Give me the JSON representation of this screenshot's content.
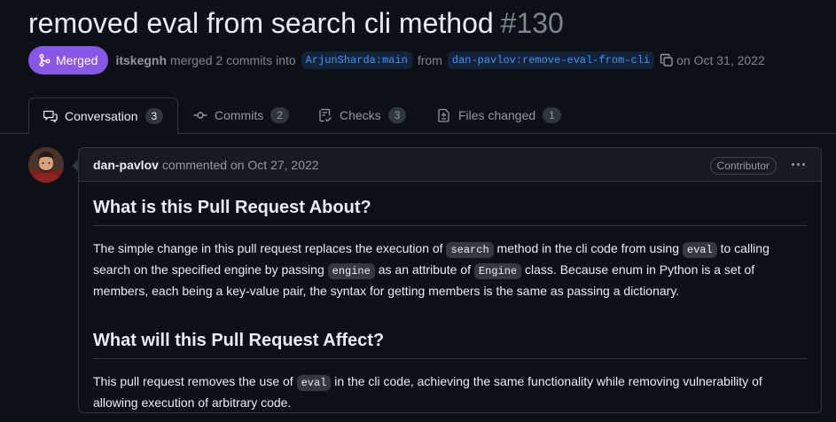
{
  "pr": {
    "title": "removed eval from search cli method",
    "number": "#130",
    "status": "Merged",
    "author": "itskegnh",
    "merged_text": "merged 2 commits into",
    "base_branch": "ArjunSharda:main",
    "from_text": "from",
    "head_branch": "dan-pavlov:remove-eval-from-cli",
    "date_text": "on Oct 31, 2022"
  },
  "tabs": [
    {
      "label": "Conversation",
      "count": "3",
      "icon": "comment-discussion-icon"
    },
    {
      "label": "Commits",
      "count": "2",
      "icon": "git-commit-icon"
    },
    {
      "label": "Checks",
      "count": "3",
      "icon": "checklist-icon"
    },
    {
      "label": "Files changed",
      "count": "1",
      "icon": "file-diff-icon"
    }
  ],
  "comment": {
    "author": "dan-pavlov",
    "action": "commented on Oct 27, 2022",
    "role": "Contributor",
    "h1": "What is this Pull Request About?",
    "p1": [
      "The simple change in this pull request replaces the execution of ",
      "search",
      " method in the cli code from using ",
      "eval",
      " to calling search on the specified engine by passing ",
      "engine",
      " as an attribute of ",
      "Engine",
      " class. Because enum in Python is a set of members, each being a key-value pair, the syntax for getting members is the same as passing a dictionary."
    ],
    "h2": "What will this Pull Request Affect?",
    "p2": [
      "This pull request removes the use of ",
      "eval",
      " in the cli code, achieving the same functionality while removing vulnerability of allowing execution of arbitrary code."
    ]
  },
  "colors": {
    "background": "#0d1117",
    "merged": "#8957e5",
    "link": "#4493f8",
    "border": "#30363d"
  }
}
